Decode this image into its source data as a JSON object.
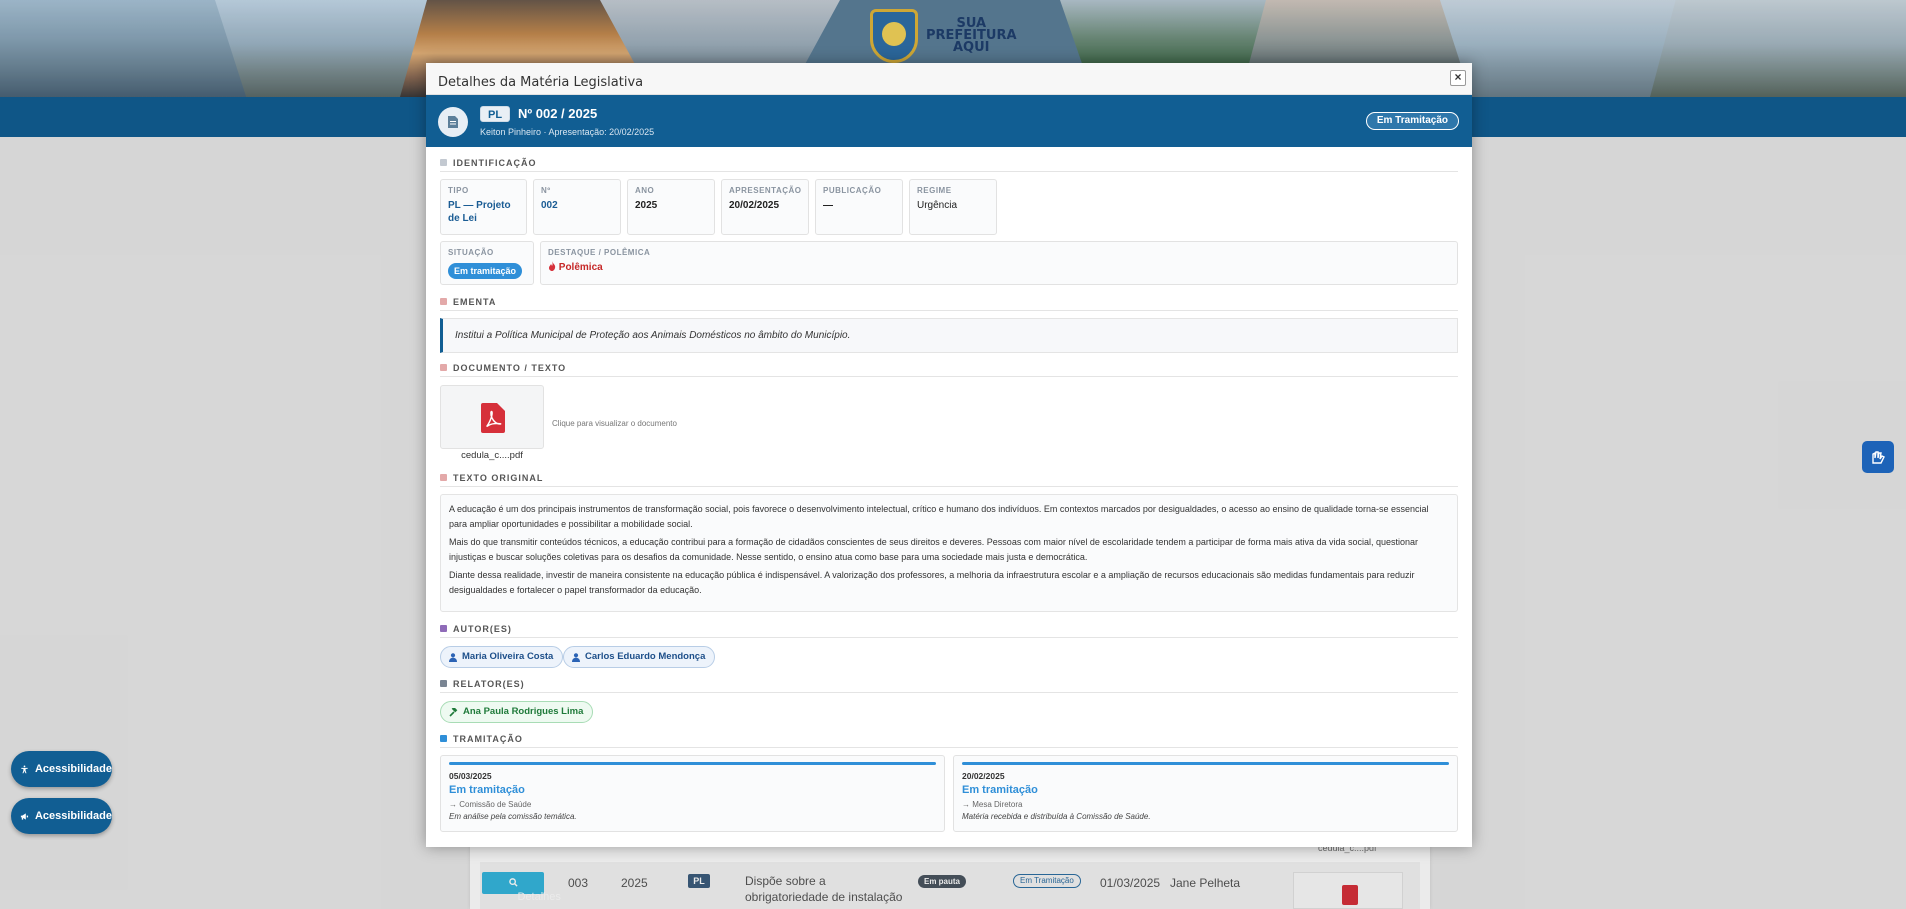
{
  "colors": {
    "primary": "#115e93",
    "status_blue": "#2f8fd8",
    "danger": "#c62828",
    "relator_green": "#1f7a3a"
  },
  "banner": {
    "logo_lines": [
      "SUA",
      "PREFEITURA",
      "AQUI"
    ]
  },
  "background_table": {
    "row": {
      "button": "Detalhes",
      "numero": "003",
      "ano": "2025",
      "tipo": "PL",
      "ementa_1": "Dispõe sobre a",
      "ementa_2": "obrigatoriedade de instalação",
      "pauta": "Em pauta",
      "status": "Em Tramitação",
      "data": "01/03/2025",
      "autor": "Jane Pelheta"
    },
    "file_label": "cedula_c....pdf"
  },
  "modal": {
    "title": "Detalhes da Matéria Legislativa",
    "close_icon": "close-icon",
    "hero": {
      "tipo_badge": "PL",
      "numero": "Nº 002 / 2025",
      "subtitle": "Keiton Pinheiro · Apresentação: 20/02/2025",
      "status": "Em Tramitação"
    },
    "identificacao": {
      "heading": "IDENTIFICAÇÃO",
      "tipo_label": "TIPO",
      "tipo_value": "PL — Projeto de Lei",
      "numero_label": "Nº",
      "numero_value": "002",
      "ano_label": "ANO",
      "ano_value": "2025",
      "apresentacao_label": "APRESENTAÇÃO",
      "apresentacao_value": "20/02/2025",
      "publicacao_label": "PUBLICAÇÃO",
      "publicacao_value": "—",
      "regime_label": "REGIME",
      "regime_value": "Urgência",
      "situacao_label": "SITUAÇÃO",
      "situacao_value": "Em tramitação",
      "destaque_label": "DESTAQUE / POLÊMICA",
      "destaque_value": "Polêmica"
    },
    "ementa": {
      "heading": "EMENTA",
      "text": "Institui a Política Municipal de Proteção aos Animais Domésticos no âmbito do Município."
    },
    "documento": {
      "heading": "DOCUMENTO / TEXTO",
      "file_name": "cedula_c....pdf",
      "hint": "Clique para visualizar o documento"
    },
    "texto_original": {
      "heading": "TEXTO ORIGINAL",
      "paragraphs": [
        "A educação é um dos principais instrumentos de transformação social, pois favorece o desenvolvimento intelectual, crítico e humano dos indivíduos. Em contextos marcados por desigualdades, o acesso ao ensino de qualidade torna-se essencial para ampliar oportunidades e possibilitar a mobilidade social.",
        "Mais do que transmitir conteúdos técnicos, a educação contribui para a formação de cidadãos conscientes de seus direitos e deveres. Pessoas com maior nível de escolaridade tendem a participar de forma mais ativa da vida social, questionar injustiças e buscar soluções coletivas para os desafios da comunidade. Nesse sentido, o ensino atua como base para uma sociedade mais justa e democrática.",
        "Diante dessa realidade, investir de maneira consistente na educação pública é indispensável. A valorização dos professores, a melhoria da infraestrutura escolar e a ampliação de recursos educacionais são medidas fundamentais para reduzir desigualdades e fortalecer o papel transformador da educação."
      ]
    },
    "autores": {
      "heading": "AUTOR(ES)",
      "items": [
        "Maria Oliveira Costa",
        "Carlos Eduardo Mendonça"
      ]
    },
    "relatores": {
      "heading": "RELATOR(ES)",
      "items": [
        "Ana Paula Rodrigues Lima"
      ]
    },
    "tramitacao": {
      "heading": "TRAMITAÇÃO",
      "items": [
        {
          "date": "05/03/2025",
          "status": "Em tramitação",
          "orgao": "→ Comissão de Saúde",
          "obs": "Em análise pela comissão temática."
        },
        {
          "date": "20/02/2025",
          "status": "Em tramitação",
          "orgao": "→ Mesa Diretora",
          "obs": "Matéria recebida e distribuída à Comissão de Saúde."
        }
      ]
    }
  },
  "floating": {
    "accessibility_1": "Acessibilidade",
    "accessibility_2": "Acessibilidade"
  }
}
